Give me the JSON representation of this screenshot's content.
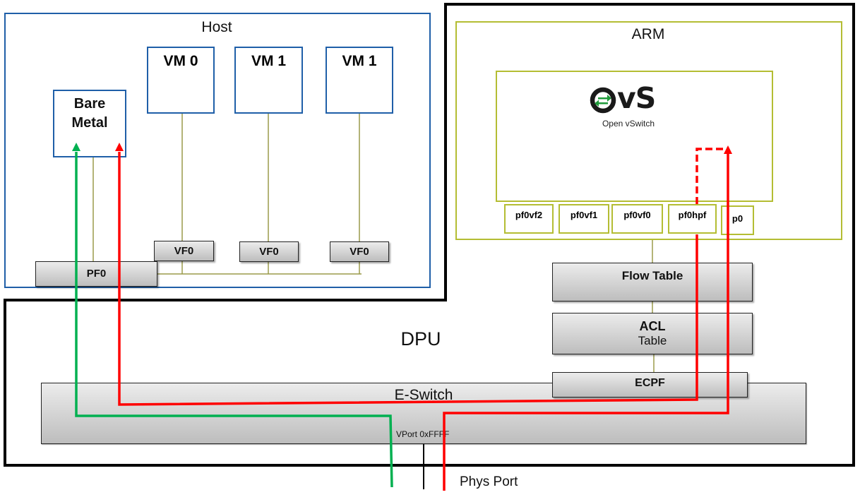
{
  "host": {
    "title": "Host",
    "bare_metal": {
      "line1": "Bare",
      "line2": "Metal"
    },
    "vms": [
      {
        "label": "VM 0",
        "vf": "VF0"
      },
      {
        "label": "VM 1",
        "vf": "VF0"
      },
      {
        "label": "VM 1",
        "vf": "VF0"
      }
    ],
    "pf": "PF0"
  },
  "dpu": {
    "title": "DPU",
    "arm": {
      "title": "ARM",
      "ovs_logo": {
        "mark": "OvS",
        "subtitle": "Open vSwitch",
        "icon": "bidirectional-arrows-icon"
      },
      "ports": [
        "pf0vf2",
        "pf0vf1",
        "pf0vf0",
        "pf0hpf",
        "p0"
      ]
    },
    "flow_table": "Flow Table",
    "acl_table": {
      "line1": "ACL",
      "line2": "Table"
    },
    "ecpf": "ECPF",
    "eswitch": {
      "title": "E-Switch",
      "vport": "VPort 0xFFFF"
    },
    "phys_port": "Phys Port"
  },
  "colors": {
    "host_border": "#1f5fa8",
    "arm_border": "#b4bd33",
    "dpu_border": "#000000",
    "path_green": "#00b050",
    "path_red": "#ff0000",
    "connector": "#9a9a4a"
  }
}
